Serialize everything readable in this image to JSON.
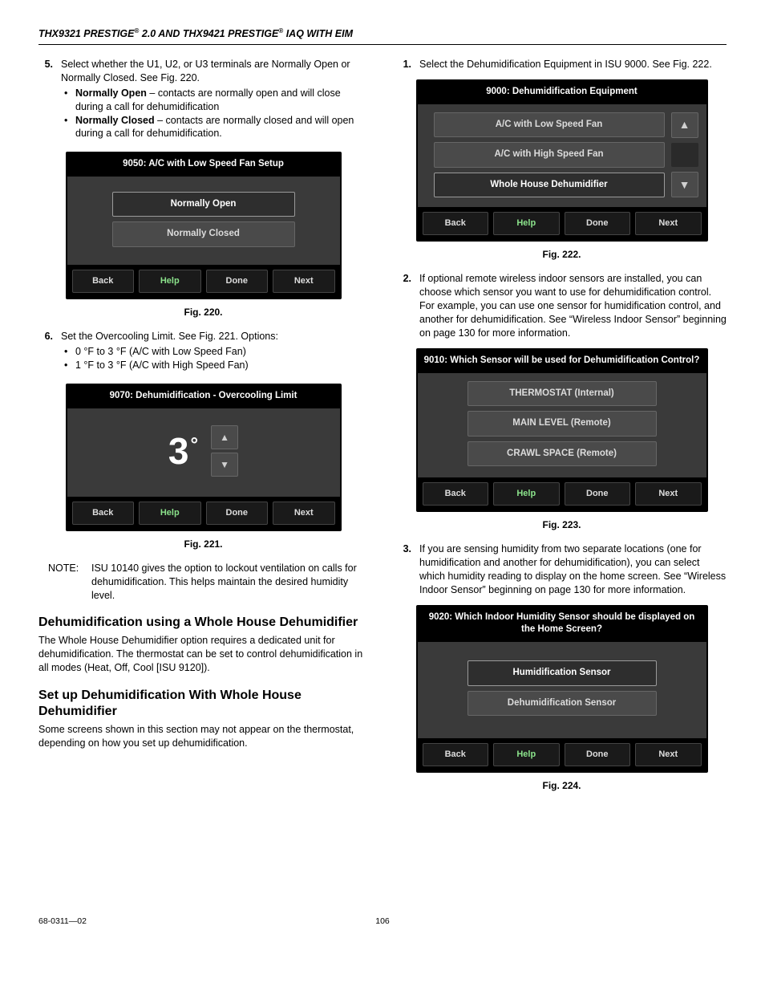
{
  "header": {
    "model_a": "THX9321 PRESTIGE",
    "version": " 2.0 AND THX9421 PRESTIGE",
    "suffix": " IAQ WITH EIM"
  },
  "left": {
    "step5": {
      "num": "5.",
      "text": "Select whether the U1, U2, or U3 terminals are Normally Open or Normally Closed. See Fig. 220.",
      "normally_open_label": "Normally Open",
      "normally_open_desc": " – contacts are normally open and will close during a call for dehumidification",
      "normally_closed_label": "Normally Closed",
      "normally_closed_desc": " – contacts are normally closed and will open during a call for dehumidification."
    },
    "fig220_caption": "Fig. 220.",
    "step6": {
      "num": "6.",
      "text": "Set the Overcooling Limit. See Fig. 221. Options:",
      "opt1": "0 °F to 3 °F (A/C with Low Speed Fan)",
      "opt2": "1 °F to 3 °F (A/C with High Speed Fan)"
    },
    "fig221_caption": "Fig. 221.",
    "note": {
      "label": "NOTE:",
      "text": "ISU 10140 gives the option to lockout ventilation on calls for dehumidification. This helps maintain the desired humidity level."
    },
    "heading1": "Dehumidification using a Whole House Dehumidifier",
    "para1": "The Whole House Dehumidifier option requires a dedicated unit for dehumidification. The thermostat can be set to control dehumidification in all modes (Heat, Off, Cool [ISU 9120]).",
    "heading2": "Set up Dehumidification With Whole House Dehumidifier",
    "para2": "Some screens shown in this section may not appear on the thermostat, depending on how you set up dehumidification."
  },
  "right": {
    "step1": {
      "num": "1.",
      "text": "Select the Dehumidification Equipment in ISU 9000. See Fig. 222."
    },
    "fig222_caption": "Fig. 222.",
    "step2": {
      "num": "2.",
      "text": "If optional remote wireless indoor sensors are installed, you can choose which sensor you want to use for dehumidification control. For example, you can use one sensor for humidification control, and another for dehumidification. See “Wireless Indoor Sensor” beginning on page 130 for more information."
    },
    "fig223_caption": "Fig. 223.",
    "step3": {
      "num": "3.",
      "text": "If you are sensing humidity from two separate locations (one for humidification and another for dehumidification), you can select which humidity reading to display on the home screen. See “Wireless Indoor Sensor” beginning on page 130 for more information."
    },
    "fig224_caption": "Fig. 224."
  },
  "screens": {
    "s220": {
      "title": "9050: A/C with Low Speed Fan Setup",
      "opt_open": "Normally Open",
      "opt_closed": "Normally Closed"
    },
    "s221": {
      "title": "9070: Dehumidification - Overcooling Limit",
      "value": "3"
    },
    "s222": {
      "title": "9000: Dehumidification Equipment",
      "opt1": "A/C with Low Speed Fan",
      "opt2": "A/C with High Speed Fan",
      "opt3": "Whole House Dehumidifier"
    },
    "s223": {
      "title": "9010: Which Sensor will be used for Dehumidification Control?",
      "opt1": "THERMOSTAT (Internal)",
      "opt2": "MAIN LEVEL (Remote)",
      "opt3": "CRAWL SPACE (Remote)"
    },
    "s224": {
      "title": "9020: Which Indoor Humidity Sensor should be displayed on the Home Screen?",
      "opt1": "Humidification Sensor",
      "opt2": "Dehumidification Sensor"
    },
    "footer": {
      "back": "Back",
      "help": "Help",
      "done": "Done",
      "next": "Next"
    }
  },
  "page_footer": {
    "doc": "68-0311—02",
    "page": "106"
  }
}
